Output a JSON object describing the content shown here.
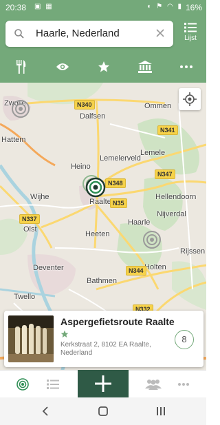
{
  "status_bar": {
    "time": "20:38",
    "battery": "16%"
  },
  "search": {
    "value": "Haarle, Nederland",
    "list_label": "Lijst"
  },
  "map": {
    "towns": [
      "Zwolle",
      "Dalfsen",
      "Ommen",
      "Hattem",
      "Lemelerveld",
      "Lemele",
      "Heino",
      "Hellendoorn",
      "Wijhe",
      "Raalte",
      "Nijverdal",
      "Olst",
      "Haarle",
      "Heeten",
      "Rijssen",
      "Deventer",
      "Holten",
      "Bathmen",
      "Twello"
    ],
    "roads": [
      "N340",
      "N341",
      "N348",
      "N347",
      "N35",
      "N337",
      "N344",
      "N332"
    ]
  },
  "card": {
    "title": "Aspergefietsroute Raalte",
    "address_line1": "Kerkstraat 2, 8102 EA Raalte,",
    "address_line2": "Nederland",
    "count": "8"
  },
  "colors": {
    "accent": "#74a97a",
    "dark_green": "#2f5a46"
  }
}
